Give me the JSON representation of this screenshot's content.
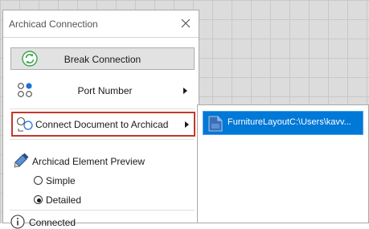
{
  "window": {
    "title": "Archicad Connection"
  },
  "buttons": {
    "break_connection": "Break Connection"
  },
  "menu": {
    "port_number": "Port Number",
    "connect_document": "Connect Document to Archicad"
  },
  "preview": {
    "label": "Archicad Element Preview",
    "options": [
      "Simple",
      "Detailed"
    ],
    "selected": "Detailed"
  },
  "status": {
    "text": "Connected"
  },
  "submenu": {
    "items": [
      {
        "label": "FurnitureLayoutC:\\Users\\kavv..."
      }
    ]
  },
  "colors": {
    "highlight_border": "#c0392b",
    "selection": "#0078d7",
    "icon_green": "#3aa34a",
    "icon_blue": "#1e6fd9"
  },
  "icons": [
    "close-icon",
    "refresh-icon",
    "port-dots-icon",
    "chevron-right-icon",
    "connect-circles-icon",
    "pencil-eraser-icon",
    "info-icon",
    "document-icon"
  ]
}
